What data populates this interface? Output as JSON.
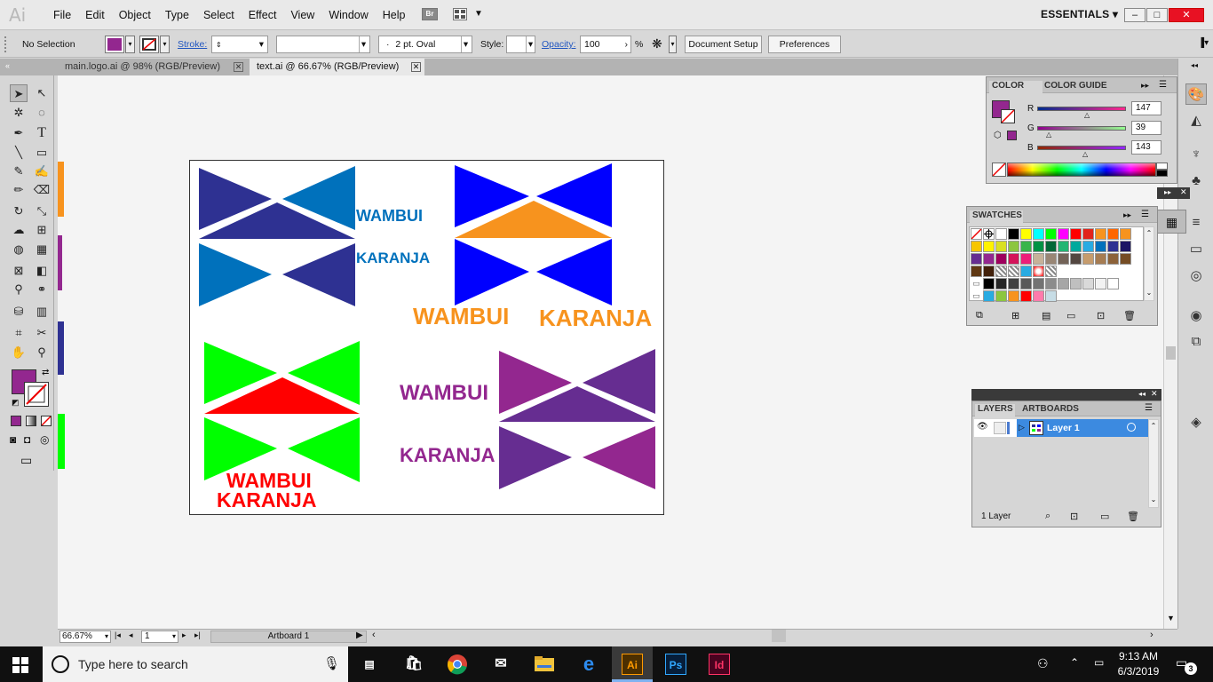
{
  "app": {
    "logo": "Ai",
    "menu": [
      "File",
      "Edit",
      "Object",
      "Type",
      "Select",
      "Effect",
      "View",
      "Window",
      "Help"
    ],
    "bridge_label": "Br",
    "workspace": "ESSENTIALS"
  },
  "control_bar": {
    "selection": "No Selection",
    "stroke_label": "Stroke:",
    "brush": "2 pt. Oval",
    "brush_dot": "·",
    "style_label": "Style:",
    "opacity_label": "Opacity:",
    "opacity_value": "100",
    "opacity_unit": "%",
    "document_setup": "Document Setup",
    "preferences": "Preferences",
    "fill_color": "#93278f"
  },
  "tabs": [
    {
      "label": "main.logo.ai @ 98% (RGB/Preview)",
      "active": false
    },
    {
      "label": "text.ai @ 66.67% (RGB/Preview)",
      "active": true
    }
  ],
  "artboard_texts": {
    "t1": "WAMBUI",
    "t2": "KARANJA",
    "t3": "WAMBUI",
    "t4": "KARANJA",
    "t5": "WAMBUI",
    "t6": "KARANJA",
    "t7": "WAMBUI",
    "t8": "KARANJA"
  },
  "colors": {
    "navy": "#2e3192",
    "cyanblue": "#0071bc",
    "blue": "#0000ff",
    "orange": "#f7931e",
    "green": "#00ff00",
    "red": "#ff0000",
    "purple": "#93278f",
    "violet": "#662d91"
  },
  "color_panel": {
    "tab_active": "COLOR",
    "tab_other": "COLOR GUIDE",
    "r_label": "R",
    "r_value": "147",
    "g_label": "G",
    "g_value": "39",
    "b_label": "B",
    "b_value": "143"
  },
  "swatches_panel": {
    "title": "SWATCHES"
  },
  "layers_panel": {
    "tab_active": "LAYERS",
    "tab_other": "ARTBOARDS",
    "layer_name": "Layer 1",
    "footer": "1 Layer"
  },
  "status_bar": {
    "zoom": "66.67%",
    "page": "1",
    "artboard": "Artboard 1"
  },
  "taskbar": {
    "search_placeholder": "Type here to search",
    "time": "9:13 AM",
    "date": "6/3/2019",
    "notifications": "3",
    "apps": [
      "Ai",
      "Ps",
      "Id"
    ]
  }
}
